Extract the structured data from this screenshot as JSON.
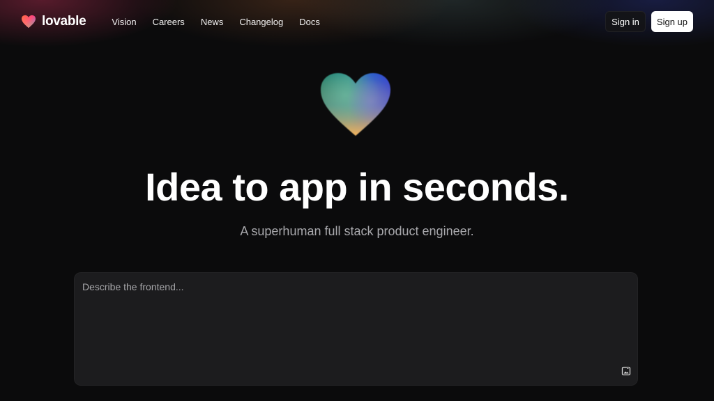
{
  "brand": {
    "name": "lovable",
    "logo_icon": "heart-gradient-icon"
  },
  "nav": {
    "links": [
      {
        "label": "Vision"
      },
      {
        "label": "Careers"
      },
      {
        "label": "News"
      },
      {
        "label": "Changelog"
      },
      {
        "label": "Docs"
      }
    ],
    "signin_label": "Sign in",
    "signup_label": "Sign up"
  },
  "hero": {
    "icon": "heart-gradient-icon",
    "title": "Idea to app in seconds.",
    "subtitle": "A superhuman full stack product engineer."
  },
  "prompt": {
    "placeholder": "Describe the frontend...",
    "value": "",
    "attach_icon": "image-upload-icon"
  },
  "colors": {
    "background": "#0b0b0c",
    "prompt_box": "#1c1c1e",
    "subtitle": "#a9a9ad",
    "signup_bg": "#ffffff"
  }
}
